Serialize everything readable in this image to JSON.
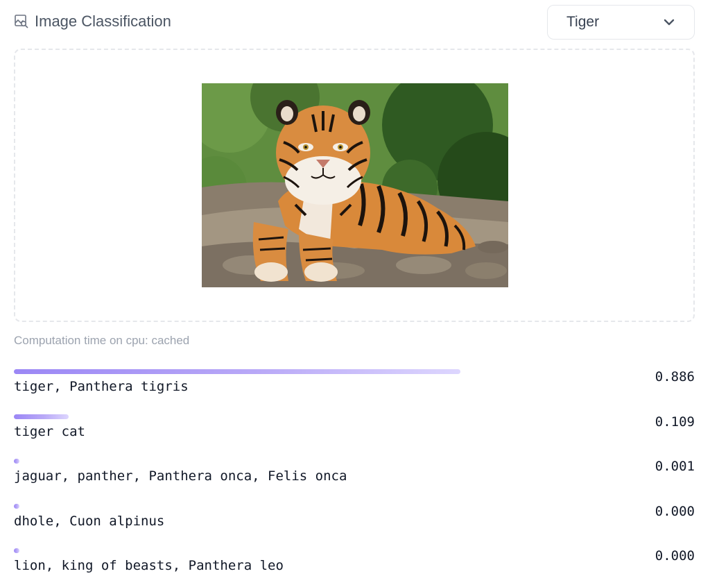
{
  "header": {
    "title": "Image Classification",
    "title_icon": "image-search-icon",
    "dropdown": {
      "selected": "Tiger",
      "icon": "chevron-down-icon"
    }
  },
  "image": {
    "subject": "tiger-photo"
  },
  "computation_time": "Computation time on cpu: cached",
  "results": [
    {
      "label": "tiger, Panthera tigris",
      "score": "0.886",
      "fraction": 0.886
    },
    {
      "label": "tiger cat",
      "score": "0.109",
      "fraction": 0.109
    },
    {
      "label": "jaguar, panther, Panthera onca, Felis onca",
      "score": "0.001",
      "fraction": 0.001
    },
    {
      "label": "dhole, Cuon alpinus",
      "score": "0.000",
      "fraction": 0.0
    },
    {
      "label": "lion, king of beasts, Panthera leo",
      "score": "0.000",
      "fraction": 0.0
    }
  ],
  "colors": {
    "bar_start": "#9b87f5",
    "bar_end": "#ddd6fe",
    "border": "#e5e7eb"
  }
}
